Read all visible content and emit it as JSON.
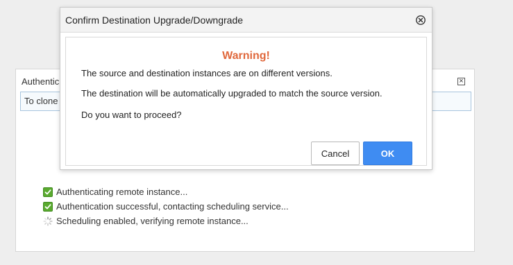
{
  "background_dialog": {
    "title": "Authenticic",
    "field_text": "To clone",
    "close_icon": "close-box-icon",
    "status_items": [
      {
        "icon": "checkbox-check-icon",
        "text": "Authenticating remote instance..."
      },
      {
        "icon": "checkbox-check-icon",
        "text": "Authentication successful, contacting scheduling service..."
      },
      {
        "icon": "spinner-icon",
        "text": "Scheduling enabled, verifying remote instance..."
      }
    ]
  },
  "modal": {
    "title": "Confirm Destination Upgrade/Downgrade",
    "close_icon": "circle-x-icon",
    "warning": "Warning!",
    "messages": [
      "The source and destination instances are on different versions.",
      "The destination will be automatically upgraded to match the source version.",
      "Do you want to proceed?"
    ],
    "cancel_label": "Cancel",
    "ok_label": "OK"
  },
  "colors": {
    "warning": "#e0683c",
    "ok_button": "#3f8cf2",
    "check": "#5aaa2f"
  }
}
